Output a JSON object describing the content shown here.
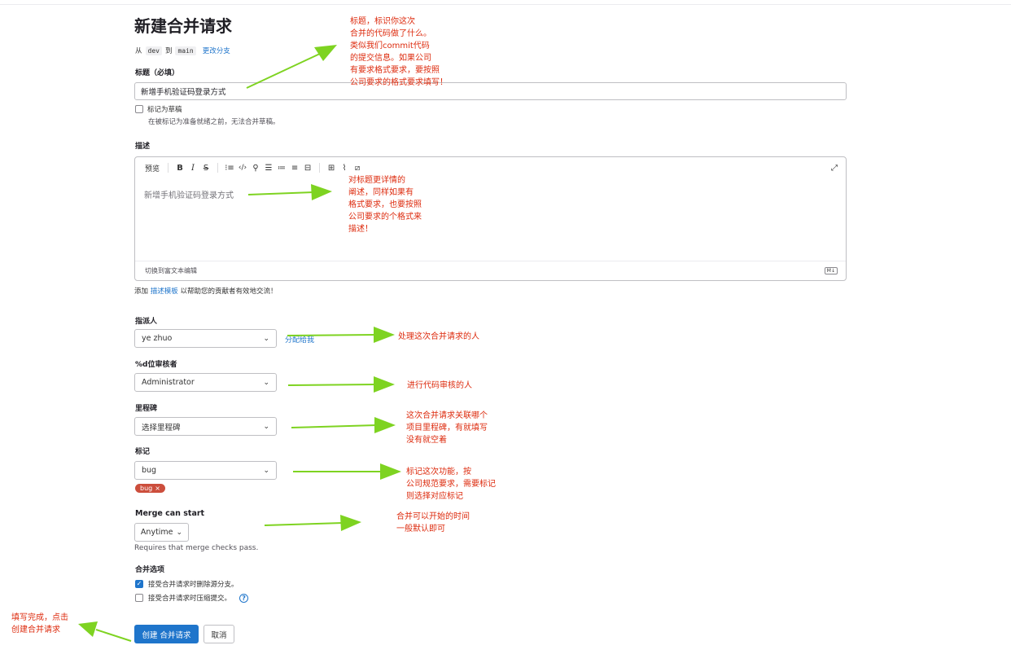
{
  "page": {
    "title": "新建合并请求",
    "branch_from_prefix": "从",
    "source_branch": "dev",
    "branch_to_word": "到",
    "target_branch": "main",
    "change_branch_link": "更改分支"
  },
  "form": {
    "title_label": "标题（必填）",
    "title_value": "新增手机验证码登录方式",
    "draft_label": "标记为草稿",
    "draft_help": "在被标记为准备就绪之前，无法合并草稿。",
    "description_label": "描述",
    "editor_toolbar": {
      "preview": "预览",
      "bold": "B",
      "italic": "I",
      "strike": "S"
    },
    "description_value": "新增手机验证码登录方式",
    "switch_rich_text": "切换到富文本编辑",
    "markdown_badge": "M↓",
    "template_help_prefix": "添加",
    "template_help_link": "描述模板",
    "template_help_suffix": "以帮助您的贡献者有效地交流！",
    "assignee_label": "指派人",
    "assignee_value": "ye zhuo",
    "assign_to_me": "分配给我",
    "reviewer_label": "%d位审核者",
    "reviewer_value": "Administrator",
    "milestone_label": "里程碑",
    "milestone_value": "选择里程碑",
    "labels_label": "标记",
    "labels_value": "bug",
    "label_tag": "bug",
    "merge_start_label": "Merge can start",
    "merge_start_value": "Anytime",
    "merge_start_help": "Requires that merge checks pass.",
    "merge_options_label": "合并选项",
    "delete_source_label": "接受合并请求时删除源分支。",
    "squash_label": "接受合并请求时压缩提交。",
    "create_button": "创建 合并请求",
    "cancel_button": "取消"
  },
  "annotations": {
    "title_note": "标题，标识你这次\n合并的代码做了什么。\n类似我们commit代码\n的提交信息。如果公司\n有要求格式要求，要按照\n公司要求的格式要求填写！",
    "description_note": "对标题更详情的\n阐述，同样如果有\n格式要求，也要按照\n公司要求的个格式来\n描述！",
    "assignee_note": "处理这次合并请求的人",
    "reviewer_note": "进行代码审核的人",
    "milestone_note": "这次合并请求关联哪个\n项目里程碑，有就填写\n没有就空着",
    "labels_note": "标记这次功能，按\n公司规范要求，需要标记\n则选择对应标记",
    "merge_start_note": "合并可以开始的时间\n一般默认即可",
    "submit_note": "填写完成，点击\n创建合并请求"
  },
  "colors": {
    "accent": "#1f75cb",
    "annotation_text": "#dd2b0e",
    "annotation_arrow": "#7ed321",
    "tag_bug": "#cc4e3c"
  }
}
